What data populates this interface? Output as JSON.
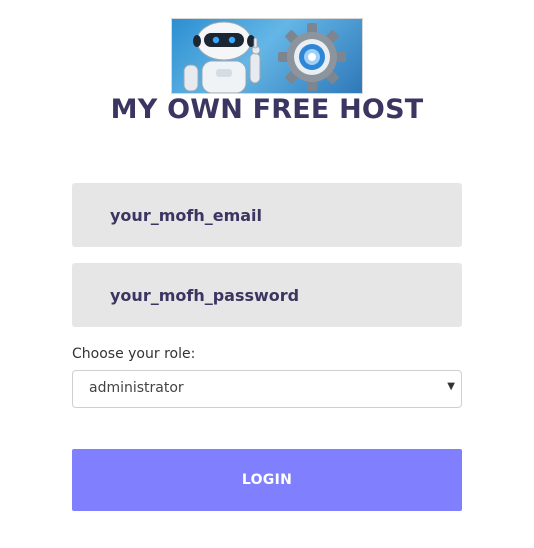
{
  "brand": {
    "title": "MY OWN FREE HOST",
    "logo_icon": "robot-gear-logo"
  },
  "form": {
    "email_placeholder": "your_mofh_email",
    "email_value": "",
    "password_placeholder": "your_mofh_password",
    "password_value": "",
    "role_label": "Choose your role:",
    "role_selected": "administrator",
    "role_arrow_icon": "dropdown-arrow-icon",
    "login_label": "LOGIN"
  },
  "colors": {
    "accent": "#8080ff",
    "title": "#3b3561",
    "field_bg": "#e6e6e6"
  }
}
